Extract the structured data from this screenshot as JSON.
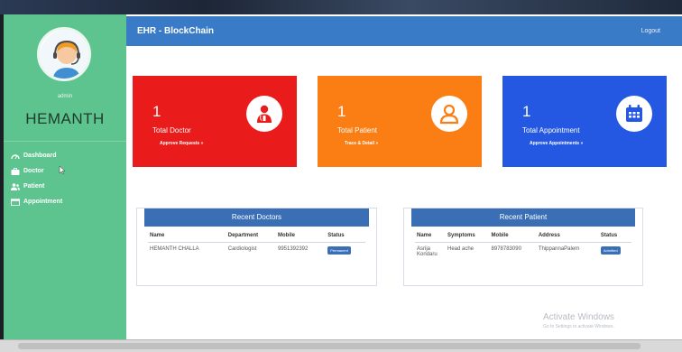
{
  "sidebar": {
    "role": "admin",
    "username": "HEMANTH",
    "items": [
      {
        "label": "Dashboard",
        "icon": "dashboard-icon"
      },
      {
        "label": "Doctor",
        "icon": "briefcase-icon"
      },
      {
        "label": "Patient",
        "icon": "users-icon"
      },
      {
        "label": "Appointment",
        "icon": "calendar-icon"
      }
    ]
  },
  "header": {
    "brand": "EHR - BlockChain",
    "logout": "Logout"
  },
  "cards": [
    {
      "count": "1",
      "label": "Total Doctor",
      "sub": "Approve Requests  »",
      "color": "#ea1b1b",
      "icon": "doctor-icon"
    },
    {
      "count": "1",
      "label": "Total Patient",
      "sub": "Trace & Detail  »",
      "color": "#fb7e15",
      "icon": "person-icon"
    },
    {
      "count": "1",
      "label": "Total Appointment",
      "sub": "Approve Appointments  »",
      "color": "#2458e3",
      "icon": "calendar-icon"
    }
  ],
  "recent_doctors": {
    "title": "Recent Doctors",
    "headers": [
      "Name",
      "Department",
      "Mobile",
      "Status"
    ],
    "rows": [
      {
        "name": "HEMANTH CHALLA",
        "department": "Cardiologist",
        "mobile": "9951392392",
        "status": "Permanent"
      }
    ]
  },
  "recent_patients": {
    "title": "Recent Patient",
    "headers": [
      "Name",
      "Symptoms",
      "Mobile",
      "Address",
      "Status"
    ],
    "rows": [
      {
        "name": "Asrija Kondaru",
        "symptoms": "Head ache",
        "mobile": "8978783090",
        "address": "ThippannaPalem",
        "status": "Admitted"
      }
    ]
  },
  "watermark": {
    "line1": "Activate Windows",
    "line2": "Go to Settings to activate Windows."
  }
}
